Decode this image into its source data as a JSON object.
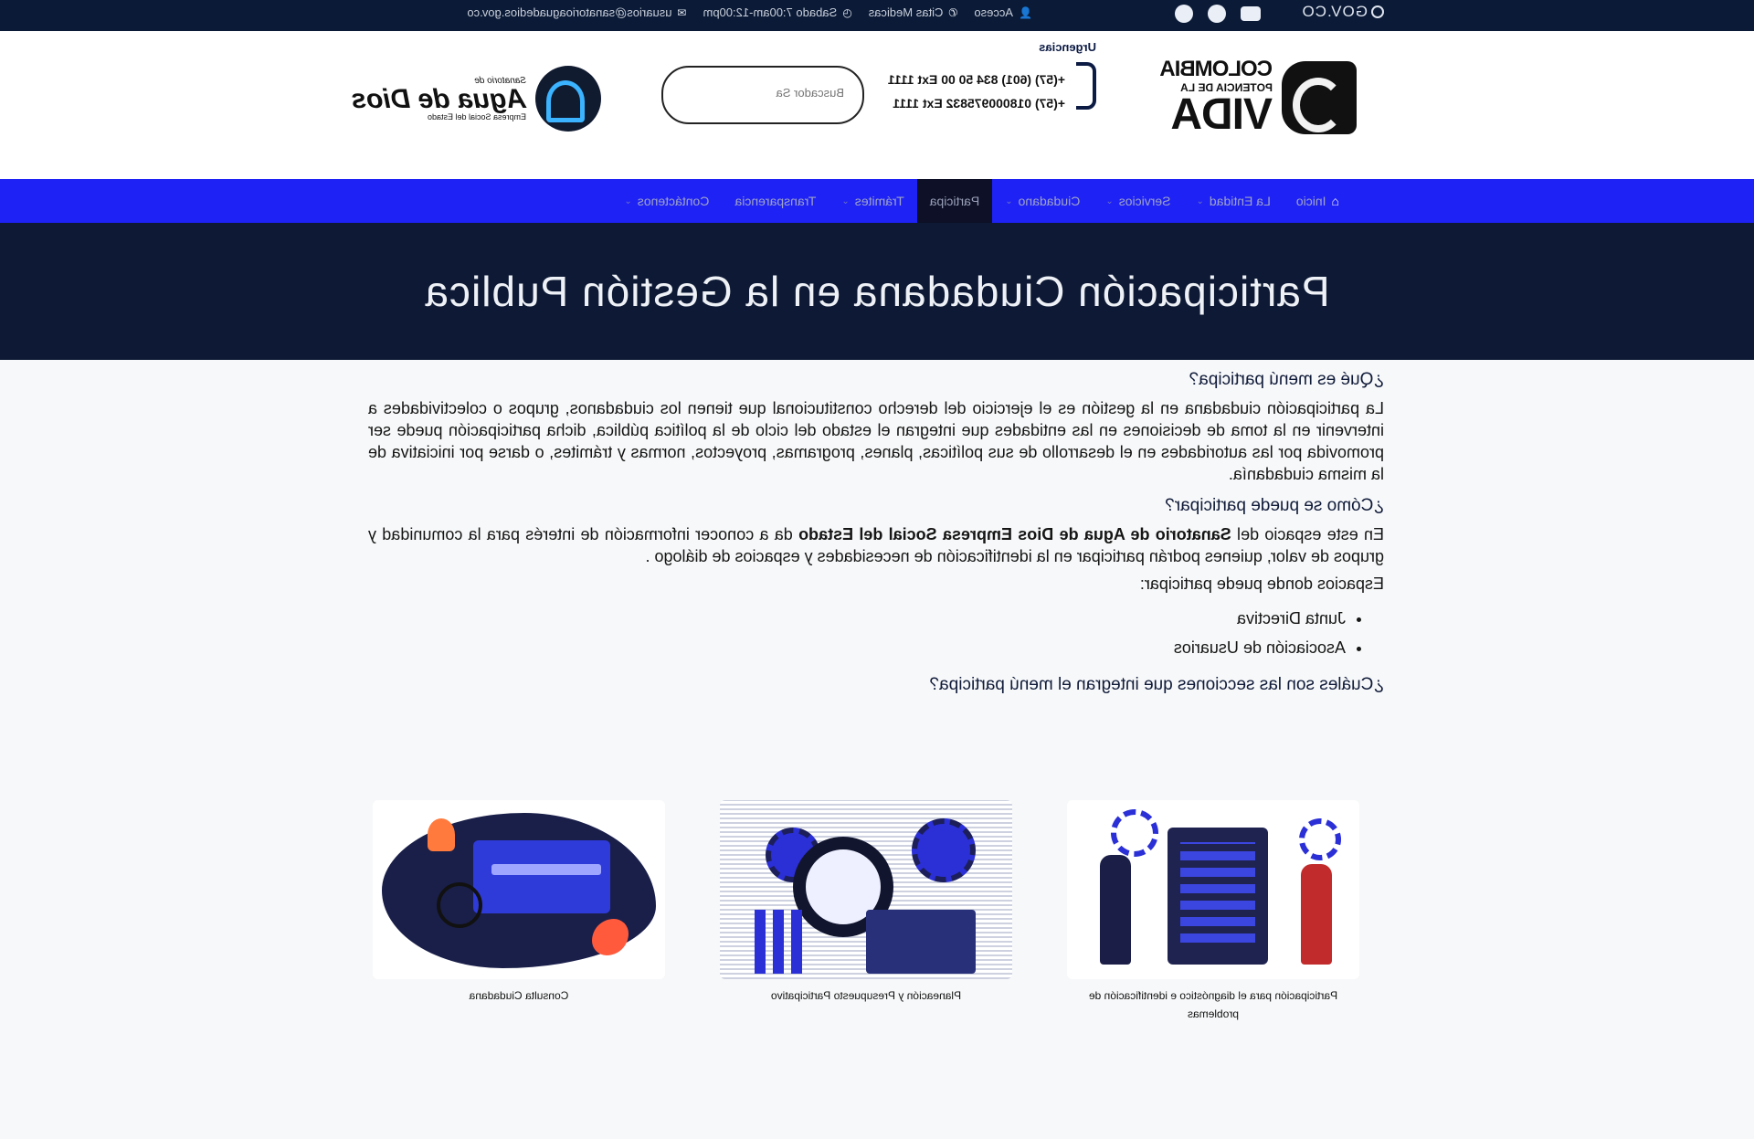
{
  "topbar": {
    "gov_logo": "GOV.CO",
    "socials": [
      "youtube-icon",
      "twitter-icon",
      "facebook-icon"
    ],
    "links": [
      {
        "label": "Acceso",
        "icon": "user-icon"
      },
      {
        "label": "Citas Medicas",
        "icon": "phone-icon"
      },
      {
        "label": "Sabado 7:00am-12:00pm",
        "icon": "clock-icon"
      },
      {
        "label": "usuarios@sanatorioaguadedios.gov.co",
        "icon": "mail-icon"
      }
    ]
  },
  "header": {
    "brand_vida": {
      "line1": "COLOMBIA",
      "line2": "POTENCIA DE LA",
      "line3": "VIDA"
    },
    "urgencias": {
      "title": "Urgencias",
      "line1": "+(57) (601) 834 50 00 Ext 1111",
      "line2": "+(57) 018000975832 Ext 1111"
    },
    "search": {
      "placeholder": "Buscador Sa"
    },
    "brand_sanatorio": {
      "small": "Sanatorio de",
      "big": "Agua de Dios",
      "sub": "Empresa Social del Estado"
    }
  },
  "nav": {
    "items": [
      {
        "label": "Inicio",
        "icon": "home-icon"
      },
      {
        "label": "La Entidad"
      },
      {
        "label": "Servicios"
      },
      {
        "label": "Ciudadano"
      },
      {
        "label": "Participa",
        "active": true
      },
      {
        "label": "Trámites"
      },
      {
        "label": "Transparencia"
      },
      {
        "label": "Contáctenos"
      }
    ]
  },
  "hero": {
    "title": "Participación Ciudadana en la Gestión Publica"
  },
  "content": {
    "q1": "¿Qué es menú participa?",
    "p1": "La participación ciudadana en la gestión es el ejercicio del derecho constitucional que tienen los ciudadanos, grupos o colectividades a intervenir en la toma de decisiones en las entidades que integran el estado del ciclo de la política pública, dicha participación puede ser promovida por las autoridades en el desarrollo de sus políticas, planes, programas, proyectos, normas y trámites, o darse por iniciativa de la misma ciudadanía.",
    "q2": "¿Cómo se puede participar?",
    "p2_a": "En este espacio del ",
    "p2_b": "Sanatorio de Agua de Dios Empresa Social del Estado",
    "p2_c": " da a conocer información de interés para la comunidad y grupos de valor, quienes podrán participar en la identificación de necesidades y espacios de diálogo .",
    "spaces_label": "Espacios donde puede participar:",
    "spaces": [
      "Junta Directiva",
      "Asociación de Usuarios"
    ],
    "q3": "¿Cuáles son las secciones que integran el menú participa?"
  },
  "cards": [
    {
      "caption": "Participación para el diagnóstico e identificación de problemas"
    },
    {
      "caption": "Planeación y Presupuesto Participativo"
    },
    {
      "caption": "Consulta Ciudadana"
    }
  ],
  "colors": {
    "topbar": "#0b1a36",
    "nav": "#1e22f4",
    "nav_active": "#0d1027",
    "hero": "#0e1a35",
    "heading": "#101b3a"
  }
}
